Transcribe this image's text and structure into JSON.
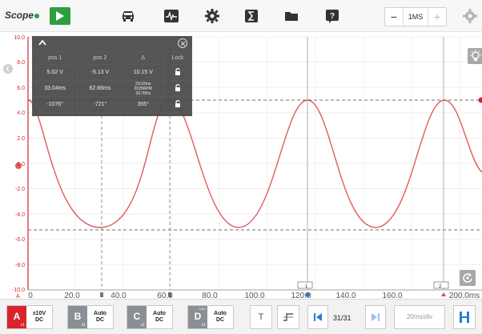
{
  "app": {
    "title": "Scope"
  },
  "toolbar": {
    "timebase_value": "1MS",
    "minus_label": "−",
    "plus_label": "+"
  },
  "axis": {
    "y_ticks": [
      "10.0",
      "8.0",
      "6.0",
      "4.0",
      "2.0",
      "0.0",
      "-2.0",
      "-4.0",
      "-6.0",
      "-8.0",
      "-10.0"
    ],
    "x_ticks": [
      "0",
      "20.0",
      "40.0",
      "60.0",
      "80.0",
      "100.0",
      "120.0",
      "140.0",
      "160.0",
      "200.0ms"
    ],
    "channel_marker": "A",
    "cursor_tag_1": "1",
    "cursor_tag_2": "2"
  },
  "measurement": {
    "headers": [
      "pos 1",
      "pos 2",
      "Δ",
      "Lock"
    ],
    "rows": [
      {
        "c1": "5.02 V",
        "c2": "-5.13 V",
        "c3": "10.15 V"
      },
      {
        "c1": "33.04ms",
        "c2": "62.66ms",
        "c3a": "29.62ms",
        "c3b": "2025RPM",
        "c3c": "33.76Hz"
      },
      {
        "c1": "-1076°",
        "c2": "-721°",
        "c3": "355°"
      }
    ]
  },
  "channels": [
    {
      "letter": "A",
      "line1": "±10V",
      "line2": "DC",
      "scale": "x1",
      "color": "#d7262b"
    },
    {
      "letter": "B",
      "line1": "Auto",
      "line2": "DC",
      "scale": "x1",
      "color": "#8a8f96"
    },
    {
      "letter": "C",
      "line1": "Auto",
      "line2": "DC",
      "scale": "x1",
      "color": "#8a8f96"
    },
    {
      "letter": "D",
      "line1": "Auto",
      "line2": "DC",
      "scale": "x1",
      "badge": "DLD",
      "color": "#8a8f96"
    }
  ],
  "bottom": {
    "trigger_label": "T",
    "page_indicator": "31/31",
    "time_div": "20ms/div"
  },
  "colors": {
    "accent_blue": "#2b7bd6",
    "trace_red": "#e05a5e",
    "channel_red": "#d7262b",
    "grid": "#e6e6e6"
  }
}
